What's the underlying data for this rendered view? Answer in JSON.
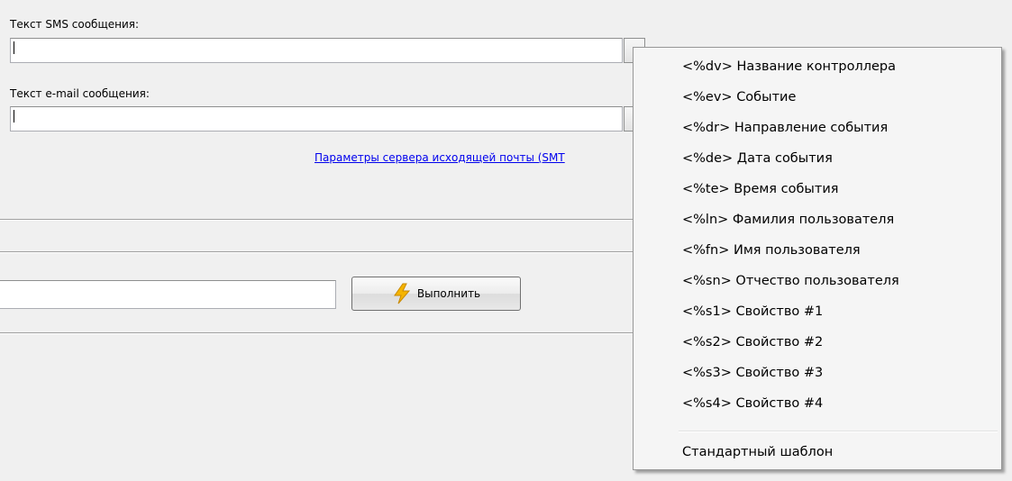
{
  "form": {
    "sms_label": "Текст SMS сообщения:",
    "sms_value": "",
    "email_label": "Текст e-mail сообщения:",
    "email_value": "",
    "smtp_link": "Параметры сервера исходящей почты (SMT",
    "execute_label": "Выполнить",
    "command_value": ""
  },
  "menu": {
    "items": [
      "<%dv> Название контроллера",
      "<%ev> Событие",
      "<%dr> Направление события",
      "<%de> Дата события",
      "<%te> Время события",
      "<%ln> Фамилия пользователя",
      "<%fn> Имя пользователя",
      "<%sn> Отчество пользователя",
      "<%s1> Свойство #1",
      "<%s2> Свойство #2",
      "<%s3> Свойство #3",
      "<%s4> Свойство #4"
    ],
    "default_template": "Стандартный шаблон"
  },
  "icons": {
    "execute": "lightning-icon"
  },
  "colors": {
    "window_bg": "#f0f0f0",
    "link": "#0000ee",
    "menu_bg": "#f5f5f5",
    "lightning": "#f5b400"
  }
}
